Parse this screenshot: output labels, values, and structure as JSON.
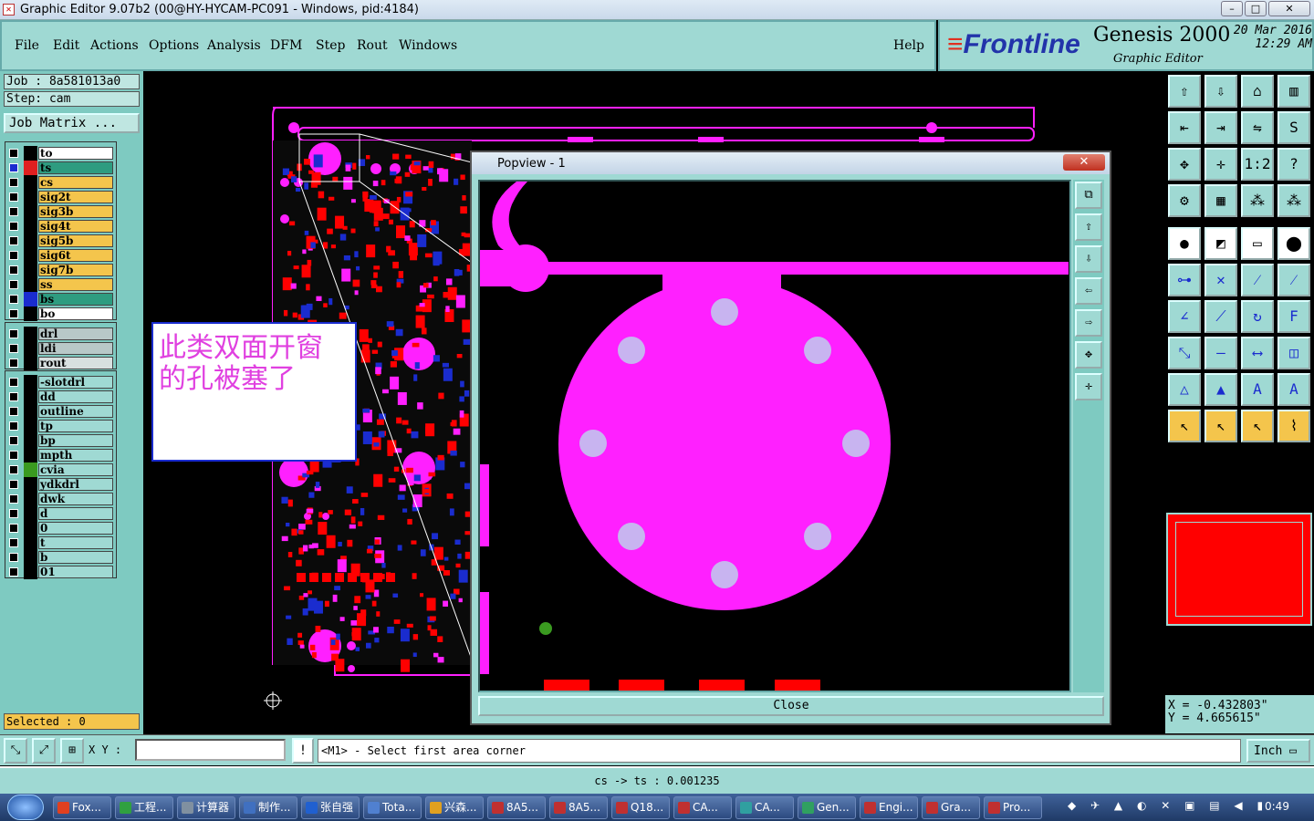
{
  "window": {
    "title": "Graphic Editor 9.07b2 (00@HY-HYCAM-PC091 - Windows, pid:4184)",
    "buttons": [
      "–",
      "□",
      "✕"
    ]
  },
  "menu": {
    "items": [
      "File",
      "Edit",
      "Actions",
      "Options",
      "Analysis",
      "DFM",
      "Step",
      "Rout",
      "Windows"
    ],
    "help": "Help"
  },
  "brand": {
    "logo": "Frontline",
    "product": "Genesis 2000",
    "subtitle": "Graphic Editor",
    "date": "20 Mar 2016",
    "time": "12:29 AM"
  },
  "job": {
    "job_line": "Job : 8a581013a0",
    "step_line": "Step: cam",
    "matrix_button": "Job Matrix ..."
  },
  "layers": {
    "group1": [
      {
        "name": "to",
        "bg": "#ffffff",
        "swatch": "#000000",
        "checked": false
      },
      {
        "name": "ts",
        "bg": "#2e9c80",
        "swatch": "#e02020",
        "checked": true
      },
      {
        "name": "cs",
        "bg": "#f4c54c",
        "swatch": "#000000",
        "checked": false
      },
      {
        "name": "sig2t",
        "bg": "#f4c54c",
        "swatch": "#000000",
        "checked": false
      },
      {
        "name": "sig3b",
        "bg": "#f4c54c",
        "swatch": "#000000",
        "checked": false
      },
      {
        "name": "sig4t",
        "bg": "#f4c54c",
        "swatch": "#000000",
        "checked": false
      },
      {
        "name": "sig5b",
        "bg": "#f4c54c",
        "swatch": "#000000",
        "checked": false
      },
      {
        "name": "sig6t",
        "bg": "#f4c54c",
        "swatch": "#000000",
        "checked": false
      },
      {
        "name": "sig7b",
        "bg": "#f4c54c",
        "swatch": "#000000",
        "checked": false
      },
      {
        "name": "ss",
        "bg": "#f4c54c",
        "swatch": "#000000",
        "checked": false
      },
      {
        "name": "bs",
        "bg": "#2e9c80",
        "swatch": "#1a2ccf",
        "checked": false
      },
      {
        "name": "bo",
        "bg": "#ffffff",
        "swatch": "#000000",
        "checked": false
      }
    ],
    "group2": [
      {
        "name": "drl",
        "bg": "#b8c8c8",
        "swatch": "#000000",
        "checked": false
      },
      {
        "name": "ldi",
        "bg": "#b8c8c8",
        "swatch": "#000000",
        "checked": false
      },
      {
        "name": "rout",
        "bg": "#d8e0e0",
        "swatch": "#000000",
        "checked": false
      }
    ],
    "group3": [
      {
        "name": "-slotdrl",
        "bg": "#9fd9d3",
        "swatch": "#000000",
        "checked": false
      },
      {
        "name": "dd",
        "bg": "#9fd9d3",
        "swatch": "#000000",
        "checked": false
      },
      {
        "name": "outline",
        "bg": "#9fd9d3",
        "swatch": "#000000",
        "checked": false
      },
      {
        "name": "tp",
        "bg": "#9fd9d3",
        "swatch": "#000000",
        "checked": false
      },
      {
        "name": "bp",
        "bg": "#9fd9d3",
        "swatch": "#000000",
        "checked": false
      },
      {
        "name": "mpth",
        "bg": "#9fd9d3",
        "swatch": "#000000",
        "checked": false
      },
      {
        "name": "cvia",
        "bg": "#9fd9d3",
        "swatch": "#3a9a20",
        "checked": false
      },
      {
        "name": "ydkdrl",
        "bg": "#9fd9d3",
        "swatch": "#000000",
        "checked": false
      },
      {
        "name": "dwk",
        "bg": "#9fd9d3",
        "swatch": "#000000",
        "checked": false
      },
      {
        "name": "d",
        "bg": "#9fd9d3",
        "swatch": "#000000",
        "checked": false
      },
      {
        "name": "0",
        "bg": "#9fd9d3",
        "swatch": "#000000",
        "checked": false
      },
      {
        "name": "t",
        "bg": "#9fd9d3",
        "swatch": "#000000",
        "checked": false
      },
      {
        "name": "b",
        "bg": "#9fd9d3",
        "swatch": "#000000",
        "checked": false
      },
      {
        "name": "01",
        "bg": "#9fd9d3",
        "swatch": "#000000",
        "checked": false
      }
    ]
  },
  "selected": "Selected : 0",
  "annotation": "此类双面开窗的孔被塞了",
  "popview": {
    "title": "Popview - 1",
    "close_label": "Close"
  },
  "coords": {
    "x": "X = -0.432803\"",
    "y": "Y = 4.665615\""
  },
  "command": {
    "xy_label": "X Y :",
    "xy_value": "",
    "prompt": "<M1> - Select first area corner",
    "units": "Inch"
  },
  "status": "cs -> ts : 0.001235",
  "taskbar": {
    "tasks": [
      {
        "label": "Fox...",
        "color": "#e04020"
      },
      {
        "label": "工程...",
        "color": "#30a040"
      },
      {
        "label": "计算器",
        "color": "#8090a0"
      },
      {
        "label": "制作...",
        "color": "#4070c0"
      },
      {
        "label": "张自强",
        "color": "#2060d0"
      },
      {
        "label": "Tota...",
        "color": "#5080d0"
      },
      {
        "label": "兴森...",
        "color": "#e0a020"
      },
      {
        "label": "8A5...",
        "color": "#c03030"
      },
      {
        "label": "8A5...",
        "color": "#c03030"
      },
      {
        "label": "Q18...",
        "color": "#c03030"
      },
      {
        "label": "CA...",
        "color": "#c03030"
      },
      {
        "label": "CA...",
        "color": "#30a0a0"
      },
      {
        "label": "Gen...",
        "color": "#30a060"
      },
      {
        "label": "Engi...",
        "color": "#c03030"
      },
      {
        "label": "Gra...",
        "color": "#c03030"
      },
      {
        "label": "Pro...",
        "color": "#c03030"
      }
    ],
    "clock": "0:49"
  },
  "colors": {
    "panel": "#9fd9d3",
    "copper": "#ff20ff",
    "pad": "#ff0000",
    "bottom": "#1a2ccf"
  }
}
